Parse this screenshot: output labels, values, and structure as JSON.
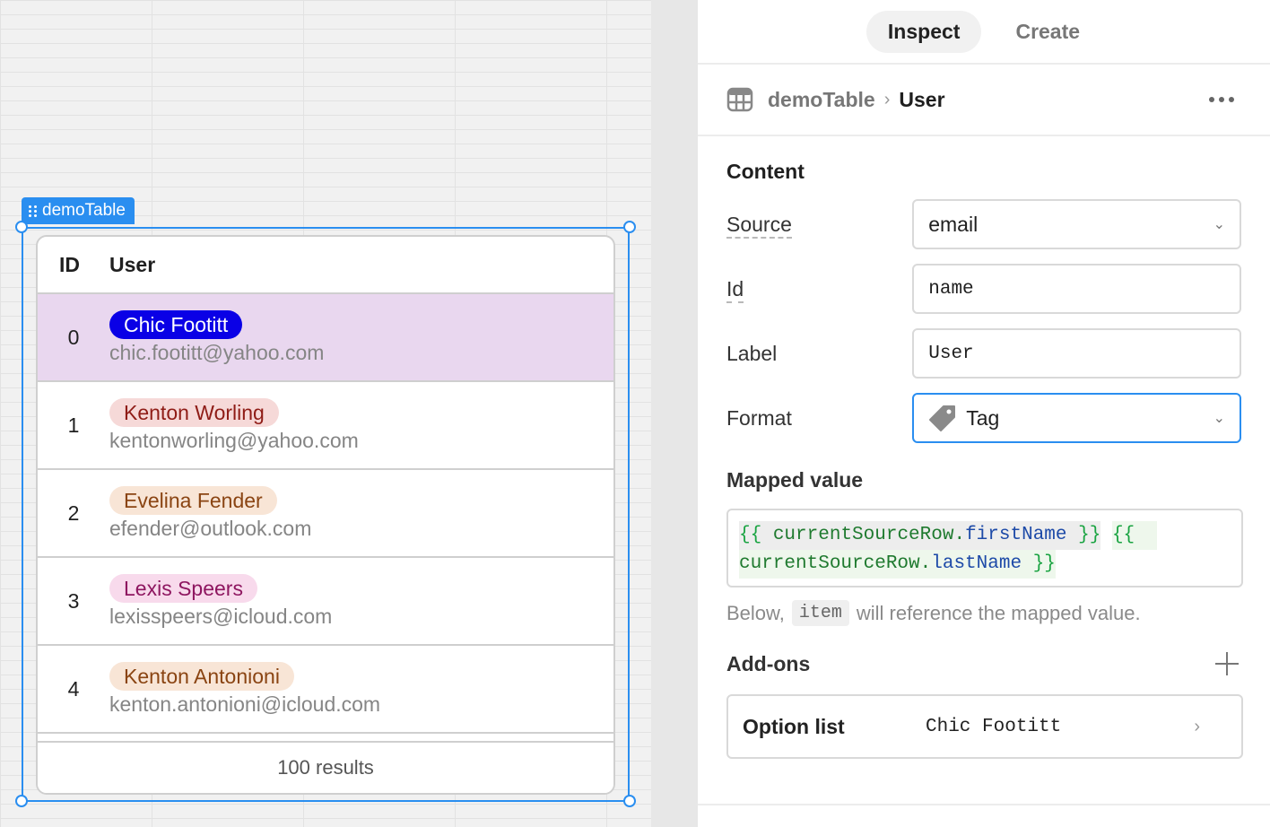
{
  "canvas": {
    "component_tag": "demoTable",
    "table": {
      "headers": {
        "id": "ID",
        "user": "User"
      },
      "rows": [
        {
          "id": "0",
          "name": "Chic Footitt",
          "email": "chic.footitt@yahoo.com",
          "tag_bg": "#0a00e6",
          "tag_fg": "#ffffff",
          "selected": true
        },
        {
          "id": "1",
          "name": "Kenton Worling",
          "email": "kentonworling@yahoo.com",
          "tag_bg": "#f6d9d8",
          "tag_fg": "#8f1c16",
          "selected": false
        },
        {
          "id": "2",
          "name": "Evelina Fender",
          "email": "efender@outlook.com",
          "tag_bg": "#f8e5d6",
          "tag_fg": "#8a4412",
          "selected": false
        },
        {
          "id": "3",
          "name": "Lexis Speers",
          "email": "lexisspeers@icloud.com",
          "tag_bg": "#f8daec",
          "tag_fg": "#8e1660",
          "selected": false
        },
        {
          "id": "4",
          "name": "Kenton Antonioni",
          "email": "kenton.antonioni@icloud.com",
          "tag_bg": "#f8e5d6",
          "tag_fg": "#8a4412",
          "selected": false
        }
      ],
      "footer": "100 results"
    }
  },
  "panel": {
    "tabs": {
      "inspect": "Inspect",
      "create": "Create"
    },
    "breadcrumb": {
      "parent": "demoTable",
      "current": "User"
    },
    "content": {
      "title": "Content",
      "source": {
        "label": "Source",
        "value": "email"
      },
      "id": {
        "label": "Id",
        "value": "name"
      },
      "label": {
        "label": "Label",
        "value": "User"
      },
      "format": {
        "label": "Format",
        "value": "Tag"
      }
    },
    "mapped": {
      "title": "Mapped value",
      "line1": {
        "open1": "{{",
        "var1": "currentSourceRow.",
        "prop1": "firstName",
        "close1": "}}",
        "open2": "{{"
      },
      "line2": {
        "var2": "currentSourceRow.",
        "prop2": "lastName",
        "close2": "}}"
      },
      "hint_before": "Below,",
      "hint_code": "item",
      "hint_after": "will reference the mapped value."
    },
    "addons": {
      "title": "Add-ons",
      "option_list": {
        "label": "Option list",
        "value": "Chic Footitt"
      }
    }
  },
  "colors": {
    "accent": "#2a8ef0",
    "selected_row": "#e9d7ef"
  }
}
